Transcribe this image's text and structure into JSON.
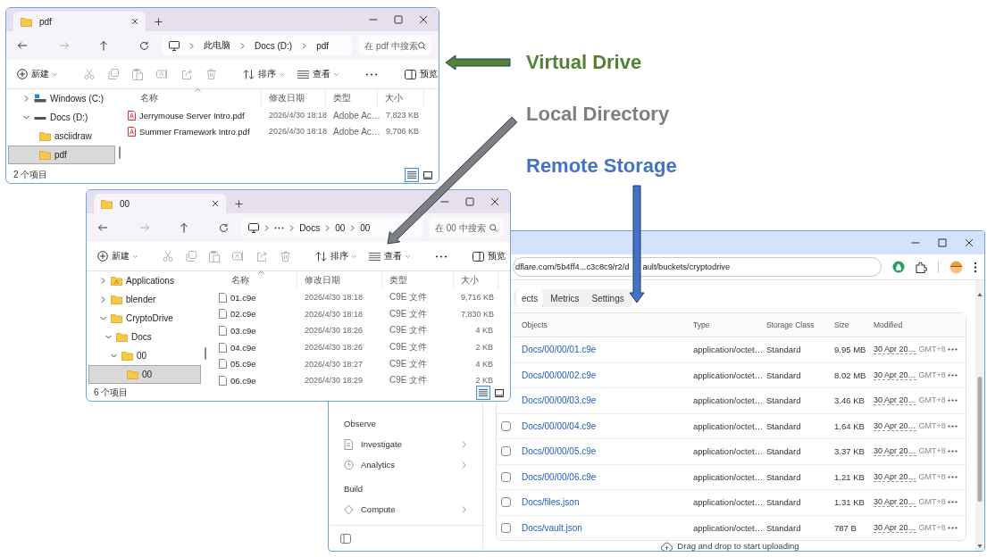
{
  "annotations": [
    {
      "text": "Virtual Drive",
      "color": "#548235"
    },
    {
      "text": "Local Directory",
      "color": "#7f7f7f"
    },
    {
      "text": "Remote Storage",
      "color": "#4472c4"
    }
  ],
  "explorers": [
    {
      "tab_title": "pdf",
      "breadcrumb": [
        {
          "kind": "text",
          "label": "此电脑"
        },
        {
          "kind": "text",
          "label": "Docs (D:)"
        },
        {
          "kind": "text",
          "label": "pdf"
        }
      ],
      "search_placeholder": "在 pdf 中搜索",
      "commands": {
        "new": "新建",
        "sort": "排序",
        "view": "查看",
        "preview": "预览"
      },
      "nav": [
        {
          "kind": "system-drive",
          "label": "Windows (C:)",
          "expanded": false,
          "selected": false
        },
        {
          "kind": "drive",
          "label": "Docs (D:)",
          "expanded": true,
          "selected": false,
          "children": [
            {
              "kind": "folder",
              "label": "asciidraw",
              "selected": false
            },
            {
              "kind": "folder",
              "label": "pdf",
              "selected": true
            }
          ]
        }
      ],
      "columns": [
        "名称",
        "修改日期",
        "类型",
        "大小"
      ],
      "files": [
        {
          "kind": "pdf",
          "name": "Jerrymouse Server Intro.pdf",
          "modified": "2026/4/30 18:18",
          "type": "Adobe Ac…",
          "size": "7,823 KB"
        },
        {
          "kind": "pdf",
          "name": "Summer Framework Intro.pdf",
          "modified": "2026/4/30 18:18",
          "type": "Adobe Ac…",
          "size": "9,706 KB"
        }
      ],
      "status": "2 个项目",
      "view_modes": [
        {
          "kind": "details",
          "selected": true
        },
        {
          "kind": "tiles",
          "selected": false
        }
      ]
    },
    {
      "tab_title": "00",
      "breadcrumb": [
        {
          "kind": "more"
        },
        {
          "kind": "text",
          "label": "Docs"
        },
        {
          "kind": "text",
          "label": "00"
        },
        {
          "kind": "text",
          "label": "00"
        }
      ],
      "search_placeholder": "在 00 中搜索",
      "commands": {
        "new": "新建",
        "sort": "排序",
        "view": "查看",
        "preview": "预览"
      },
      "nav": [
        {
          "kind": "app-folder",
          "label": "Applications",
          "expanded": false,
          "selected": false
        },
        {
          "kind": "folder",
          "label": "blender",
          "expanded": false,
          "selected": false
        },
        {
          "kind": "folder",
          "label": "CryptoDrive",
          "expanded": true,
          "selected": false,
          "children": [
            {
              "kind": "folder",
              "label": "Docs",
              "expanded": true,
              "selected": false,
              "children": [
                {
                  "kind": "folder",
                  "label": "00",
                  "expanded": true,
                  "selected": false,
                  "children": [
                    {
                      "kind": "folder",
                      "label": "00",
                      "selected": true
                    }
                  ]
                }
              ]
            }
          ]
        }
      ],
      "columns": [
        "名称",
        "修改日期",
        "类型",
        "大小"
      ],
      "files": [
        {
          "kind": "file",
          "name": "01.c9e",
          "modified": "2026/4/30 18:18",
          "type": "C9E 文件",
          "size": "9,716 KB"
        },
        {
          "kind": "file",
          "name": "02.c9e",
          "modified": "2026/4/30 18:18",
          "type": "C9E 文件",
          "size": "7,830 KB"
        },
        {
          "kind": "file",
          "name": "03.c9e",
          "modified": "2026/4/30 18:26",
          "type": "C9E 文件",
          "size": "4 KB"
        },
        {
          "kind": "file",
          "name": "04.c9e",
          "modified": "2026/4/30 18:26",
          "type": "C9E 文件",
          "size": "2 KB"
        },
        {
          "kind": "file",
          "name": "05.c9e",
          "modified": "2026/4/30 18:27",
          "type": "C9E 文件",
          "size": "4 KB"
        },
        {
          "kind": "file",
          "name": "06.c9e",
          "modified": "2026/4/30 18:29",
          "type": "C9E 文件",
          "size": "2 KB"
        }
      ],
      "status": "6 个项目",
      "view_modes": [
        {
          "kind": "details",
          "selected": true
        },
        {
          "kind": "tiles",
          "selected": false
        }
      ]
    }
  ],
  "browser": {
    "url_parts": [
      "dflare.com/5b4ff4...c3c8c9/r2/d",
      "ault/buckets/cryptodrive"
    ],
    "tabs": [
      {
        "label": "ects",
        "selected": true
      },
      {
        "label": "Metrics",
        "selected": false
      },
      {
        "label": "Settings",
        "selected": false
      }
    ],
    "sidebar": [
      {
        "kind": "heading",
        "label": "Observe"
      },
      {
        "kind": "item",
        "label": "Investigate"
      },
      {
        "kind": "item",
        "label": "Analytics"
      },
      {
        "kind": "heading",
        "label": "Build"
      },
      {
        "kind": "item",
        "label": "Compute"
      }
    ],
    "columns": [
      "Objects",
      "Type",
      "Storage Class",
      "Size",
      "Modified"
    ],
    "rows": [
      {
        "name": "Docs/00/00/01.c9e",
        "type": "application/octet…",
        "storage_class": "Standard",
        "size": "9.95 MB",
        "modified": "30 Apr 20…",
        "timezone": "GMT+8"
      },
      {
        "name": "Docs/00/00/02.c9e",
        "type": "application/octet…",
        "storage_class": "Standard",
        "size": "8.02 MB",
        "modified": "30 Apr 20…",
        "timezone": "GMT+8"
      },
      {
        "name": "Docs/00/00/03.c9e",
        "type": "application/octet…",
        "storage_class": "Standard",
        "size": "3.46 KB",
        "modified": "30 Apr 20…",
        "timezone": "GMT+8"
      },
      {
        "checked": false,
        "name": "Docs/00/00/04.c9e",
        "type": "application/octet…",
        "storage_class": "Standard",
        "size": "1.64 KB",
        "modified": "30 Apr 20…",
        "timezone": "GMT+8"
      },
      {
        "checked": false,
        "name": "Docs/00/00/05.c9e",
        "type": "application/octet…",
        "storage_class": "Standard",
        "size": "3.37 KB",
        "modified": "30 Apr 20…",
        "timezone": "GMT+8"
      },
      {
        "checked": false,
        "name": "Docs/00/00/06.c9e",
        "type": "application/octet…",
        "storage_class": "Standard",
        "size": "1.21 KB",
        "modified": "30 Apr 20…",
        "timezone": "GMT+8"
      },
      {
        "checked": false,
        "name": "Docs/files.json",
        "type": "application/octet…",
        "storage_class": "Standard",
        "size": "1.31 KB",
        "modified": "30 Apr 20…",
        "timezone": "GMT+8"
      },
      {
        "checked": false,
        "name": "Docs/vault.json",
        "type": "application/octet…",
        "storage_class": "Standard",
        "size": "787 B",
        "modified": "30 Apr 20…",
        "timezone": "GMT+8"
      }
    ],
    "upload_hint": "Drag and drop to start uploading"
  }
}
